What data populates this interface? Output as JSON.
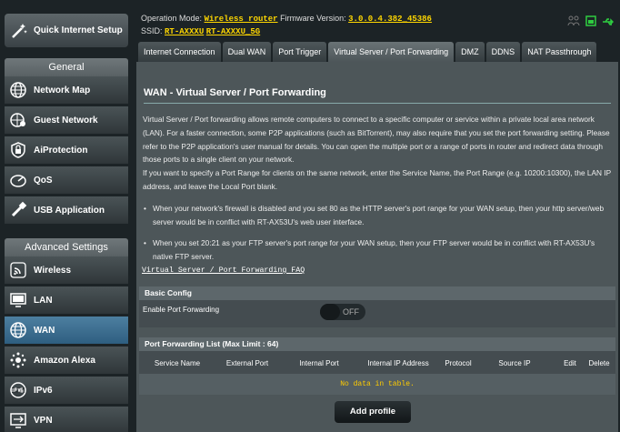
{
  "sidebar": {
    "quick_setup": "Quick Internet Setup",
    "general_header": "General",
    "general_items": [
      "Network Map",
      "Guest Network",
      "AiProtection",
      "QoS",
      "USB Application"
    ],
    "advanced_header": "Advanced Settings",
    "advanced_items": [
      "Wireless",
      "LAN",
      "WAN",
      "Amazon Alexa",
      "IPv6",
      "VPN"
    ],
    "active_item": "WAN"
  },
  "header": {
    "op_mode_label": "Operation Mode:",
    "op_mode_value": "Wireless router",
    "fw_label": "Firmware Version:",
    "fw_value": "3.0.0.4.382_45386",
    "ssid_label": "SSID:",
    "ssid_1": "RT-AXXXU",
    "ssid_2": "RT-AXXXU_5G",
    "status_icons": [
      "users-icon",
      "router-status-icon",
      "usb-icon"
    ]
  },
  "tabs": [
    {
      "label": "Internet Connection",
      "active": false
    },
    {
      "label": "Dual WAN",
      "active": false
    },
    {
      "label": "Port Trigger",
      "active": false
    },
    {
      "label": "Virtual Server / Port Forwarding",
      "active": true
    },
    {
      "label": "DMZ",
      "active": false
    },
    {
      "label": "DDNS",
      "active": false
    },
    {
      "label": "NAT Passthrough",
      "active": false
    }
  ],
  "main": {
    "title": "WAN - Virtual Server / Port Forwarding",
    "description_1": "Virtual Server / Port forwarding allows remote computers to connect to a specific computer or service within a private local area network (LAN). For a faster connection, some P2P applications (such as BitTorrent), may also require that you set the port forwarding setting. Please refer to the P2P application's user manual for details. You can open the multiple port or a range of ports in router and redirect data through those ports to a single client on your network.",
    "description_2": "If you want to specify a Port Range for clients on the same network, enter the Service Name, the Port Range (e.g. 10200:10300), the LAN IP address, and leave the Local Port blank.",
    "bullet_1": "When your network's firewall is disabled and you set 80 as the HTTP server's port range for your WAN setup, then your http server/web server would be in conflict with RT-AX53U's web user interface.",
    "bullet_2": "When you set 20:21 as your FTP server's port range for your WAN setup, then your FTP server would be in conflict with RT-AX53U's native FTP server.",
    "faq_link": "Virtual Server / Port Forwarding FAQ",
    "basic_config_header": "Basic Config",
    "enable_label": "Enable Port Forwarding",
    "enable_value": "OFF",
    "list_header": "Port Forwarding List (Max Limit : 64)",
    "columns": [
      "Service Name",
      "External Port",
      "Internal Port",
      "Internal IP Address",
      "Protocol",
      "Source IP",
      "Edit",
      "Delete"
    ],
    "no_data": "No data in table.",
    "add_button": "Add profile"
  }
}
